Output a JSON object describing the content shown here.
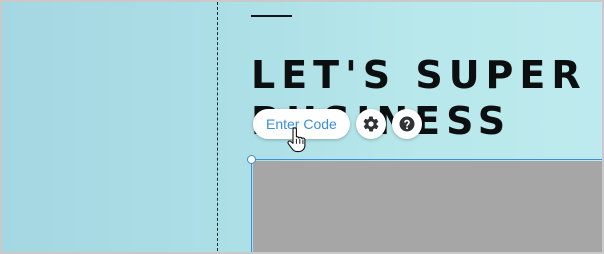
{
  "headline": {
    "line1": "LET'S SUPER",
    "line2": "BUSINESS"
  },
  "toolbar": {
    "enter_code_label": "Enter Code",
    "settings_icon": "gear-icon",
    "help_icon": "question-mark-icon"
  },
  "colors": {
    "background": "#aee0e7",
    "accent_link": "#3b8ddf",
    "selection": "#3a8fd8",
    "placeholder_box": "#a6a6a6",
    "headline_text": "#0c0f10"
  },
  "cursor": {
    "icon": "hand-pointer-icon"
  }
}
